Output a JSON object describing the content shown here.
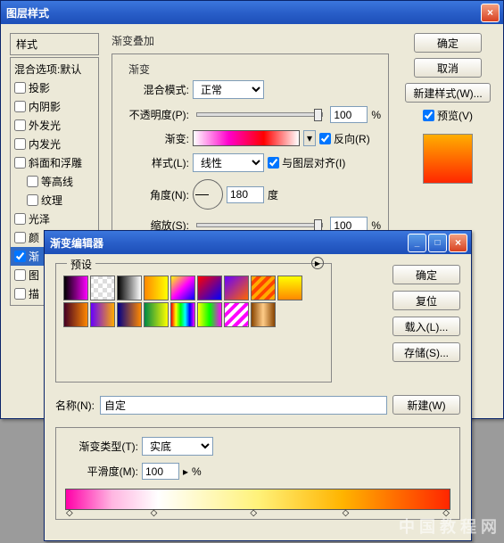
{
  "layer_style_window": {
    "title": "图层样式",
    "styles_header": "样式",
    "blend_options": "混合选项:默认",
    "style_items": [
      {
        "label": "投影",
        "checked": false
      },
      {
        "label": "内阴影",
        "checked": false
      },
      {
        "label": "外发光",
        "checked": false
      },
      {
        "label": "内发光",
        "checked": false
      },
      {
        "label": "斜面和浮雕",
        "checked": false
      },
      {
        "label": "等高线",
        "checked": false,
        "sub": true
      },
      {
        "label": "纹理",
        "checked": false,
        "sub": true
      },
      {
        "label": "光泽",
        "checked": false
      },
      {
        "label": "颜",
        "checked": false
      },
      {
        "label": "渐",
        "checked": true,
        "selected": true
      },
      {
        "label": "图",
        "checked": false
      },
      {
        "label": "描",
        "checked": false
      }
    ],
    "section_title": "渐变叠加",
    "fieldset_title": "渐变",
    "blend_mode_label": "混合模式:",
    "blend_mode_value": "正常",
    "opacity_label": "不透明度(P):",
    "opacity_value": "100",
    "percent": "%",
    "gradient_label": "渐变:",
    "reverse_label": "反向(R)",
    "style_label": "样式(L):",
    "style_value": "线性",
    "align_label": "与图层对齐(I)",
    "angle_label": "角度(N):",
    "angle_value": "180",
    "degree": "度",
    "scale_label": "缩放(S):",
    "scale_value": "100",
    "buttons": {
      "ok": "确定",
      "cancel": "取消",
      "new_style": "新建样式(W)...",
      "preview": "预览(V)"
    }
  },
  "gradient_editor": {
    "title": "渐变编辑器",
    "presets_label": "预设",
    "preset_swatches": [
      "linear-gradient(to right,#000,#f0f)",
      "repeating-conic-gradient(#fff 0 25%,#ddd 0 50%) 50%/10px 10px",
      "linear-gradient(to right,#000,#fff)",
      "linear-gradient(to right,#f80,#ff0)",
      "linear-gradient(135deg,#ff0,#f0f,#00f)",
      "linear-gradient(135deg,#f00,#00f)",
      "linear-gradient(135deg,#60f,#f60)",
      "repeating-linear-gradient(135deg,#fa0 0 4px,#f40 4px 8px)",
      "linear-gradient(to bottom,#ff0,#f80)",
      "linear-gradient(to right,#402,#f80)",
      "linear-gradient(to right,#60f,#fa0)",
      "linear-gradient(to right,#008,#f80)",
      "linear-gradient(to right,#084,#ff0)",
      "linear-gradient(to right,#f00,#ff0,#0f0,#0ff,#00f,#f0f)",
      "linear-gradient(to right,#ff0,#0f0,#f0f)",
      "repeating-linear-gradient(135deg,#f0f 0 4px,#fff 4px 8px)",
      "linear-gradient(to right,#840,#fc8,#840)"
    ],
    "name_label": "名称(N):",
    "name_value": "自定",
    "new_btn": "新建(W)",
    "type_label": "渐变类型(T):",
    "type_value": "实底",
    "smoothness_label": "平滑度(M):",
    "smoothness_value": "100",
    "percent": "%",
    "buttons": {
      "ok": "确定",
      "reset": "复位",
      "load": "载入(L)...",
      "save": "存储(S)..."
    }
  },
  "watermark": "中 国 教 程 网"
}
